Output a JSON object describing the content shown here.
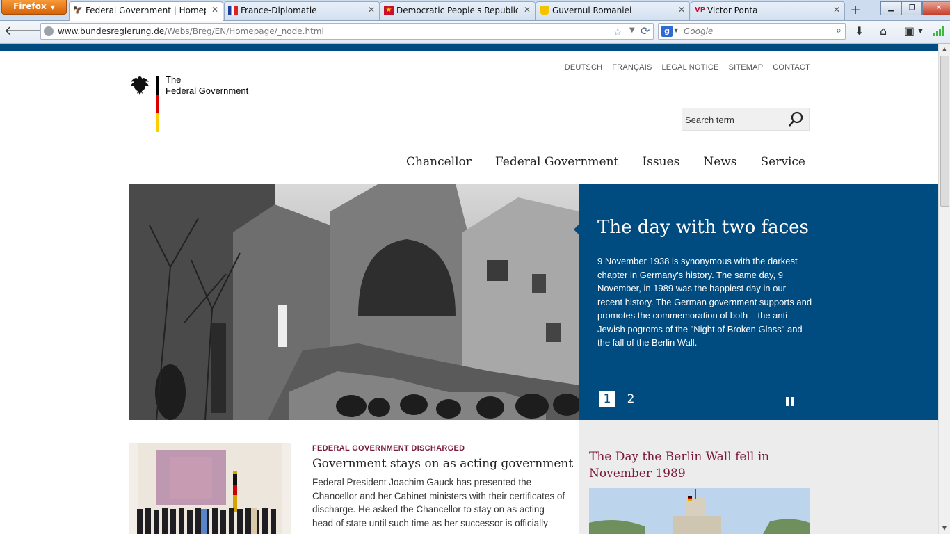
{
  "browser": {
    "app_button": "Firefox",
    "tabs": [
      {
        "title": "Federal Government | Homepage",
        "active": true
      },
      {
        "title": "France-Diplomatie",
        "active": false
      },
      {
        "title": "Democratic People's Republic of...",
        "active": false
      },
      {
        "title": "Guvernul Romaniei",
        "active": false
      },
      {
        "title": "Victor Ponta",
        "active": false,
        "favicon_text": "VP"
      }
    ],
    "url_host": "www.bundesregierung.de",
    "url_path": "/Webs/Breg/EN/Homepage/_node.html",
    "search_placeholder": "Google",
    "search_engine_letter": "g",
    "accent_color": "#e87a14"
  },
  "site": {
    "logo": {
      "line1": "The",
      "line2": "Federal Government"
    },
    "top_links": [
      "DEUTSCH",
      "FRANÇAIS",
      "LEGAL NOTICE",
      "SITEMAP",
      "CONTACT"
    ],
    "search_placeholder": "Search term",
    "main_nav": [
      "Chancellor",
      "Federal Government",
      "Issues",
      "News",
      "Service"
    ],
    "brand_color": "#004b80",
    "accent_color": "#7a1a3c",
    "hero": {
      "title": "The day with two faces",
      "text": "9 November 1938 is synonymous with the darkest chapter in Germany's history. The same day, 9 November, in 1989 was the happiest day in our recent history. The German government supports and promotes the commemoration of both – the anti-Jewish pogroms of the \"Night of Broken Glass\" and the fall of the Berlin Wall.",
      "pages": [
        "1",
        "2"
      ],
      "current_page": "1"
    },
    "news": {
      "kicker": "FEDERAL GOVERNMENT DISCHARGED",
      "title": "Government stays on as acting government",
      "text": "Federal President Joachim Gauck has presented the Chancellor and her Cabinet ministers with their certificates of discharge. He asked the Chancellor to stay on as acting head of state until such time as her successor is officially"
    },
    "sidebar": {
      "title": "The Day the Berlin Wall fell in November 1989"
    }
  }
}
